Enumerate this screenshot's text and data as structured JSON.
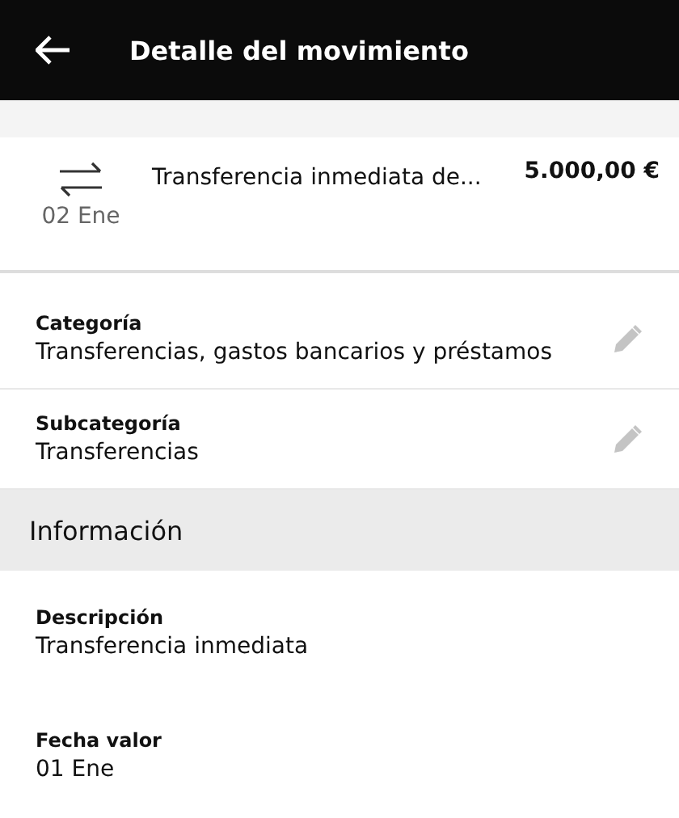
{
  "header": {
    "title": "Detalle del movimiento"
  },
  "movement": {
    "date": "02 Ene",
    "concept": "Transferencia inmediata de...",
    "amount": "5.000,00 €"
  },
  "fields": [
    {
      "label": "Categoría",
      "value": "Transferencias, gastos bancarios y préstamos",
      "editable": true
    },
    {
      "label": "Subcategoría",
      "value": "Transferencias",
      "editable": true
    }
  ],
  "info": {
    "title": "Información",
    "fields": [
      {
        "label": "Descripción",
        "value": "Transferencia inmediata",
        "editable": false
      },
      {
        "label": "Fecha valor",
        "value": "01 Ene",
        "editable": false
      }
    ]
  }
}
